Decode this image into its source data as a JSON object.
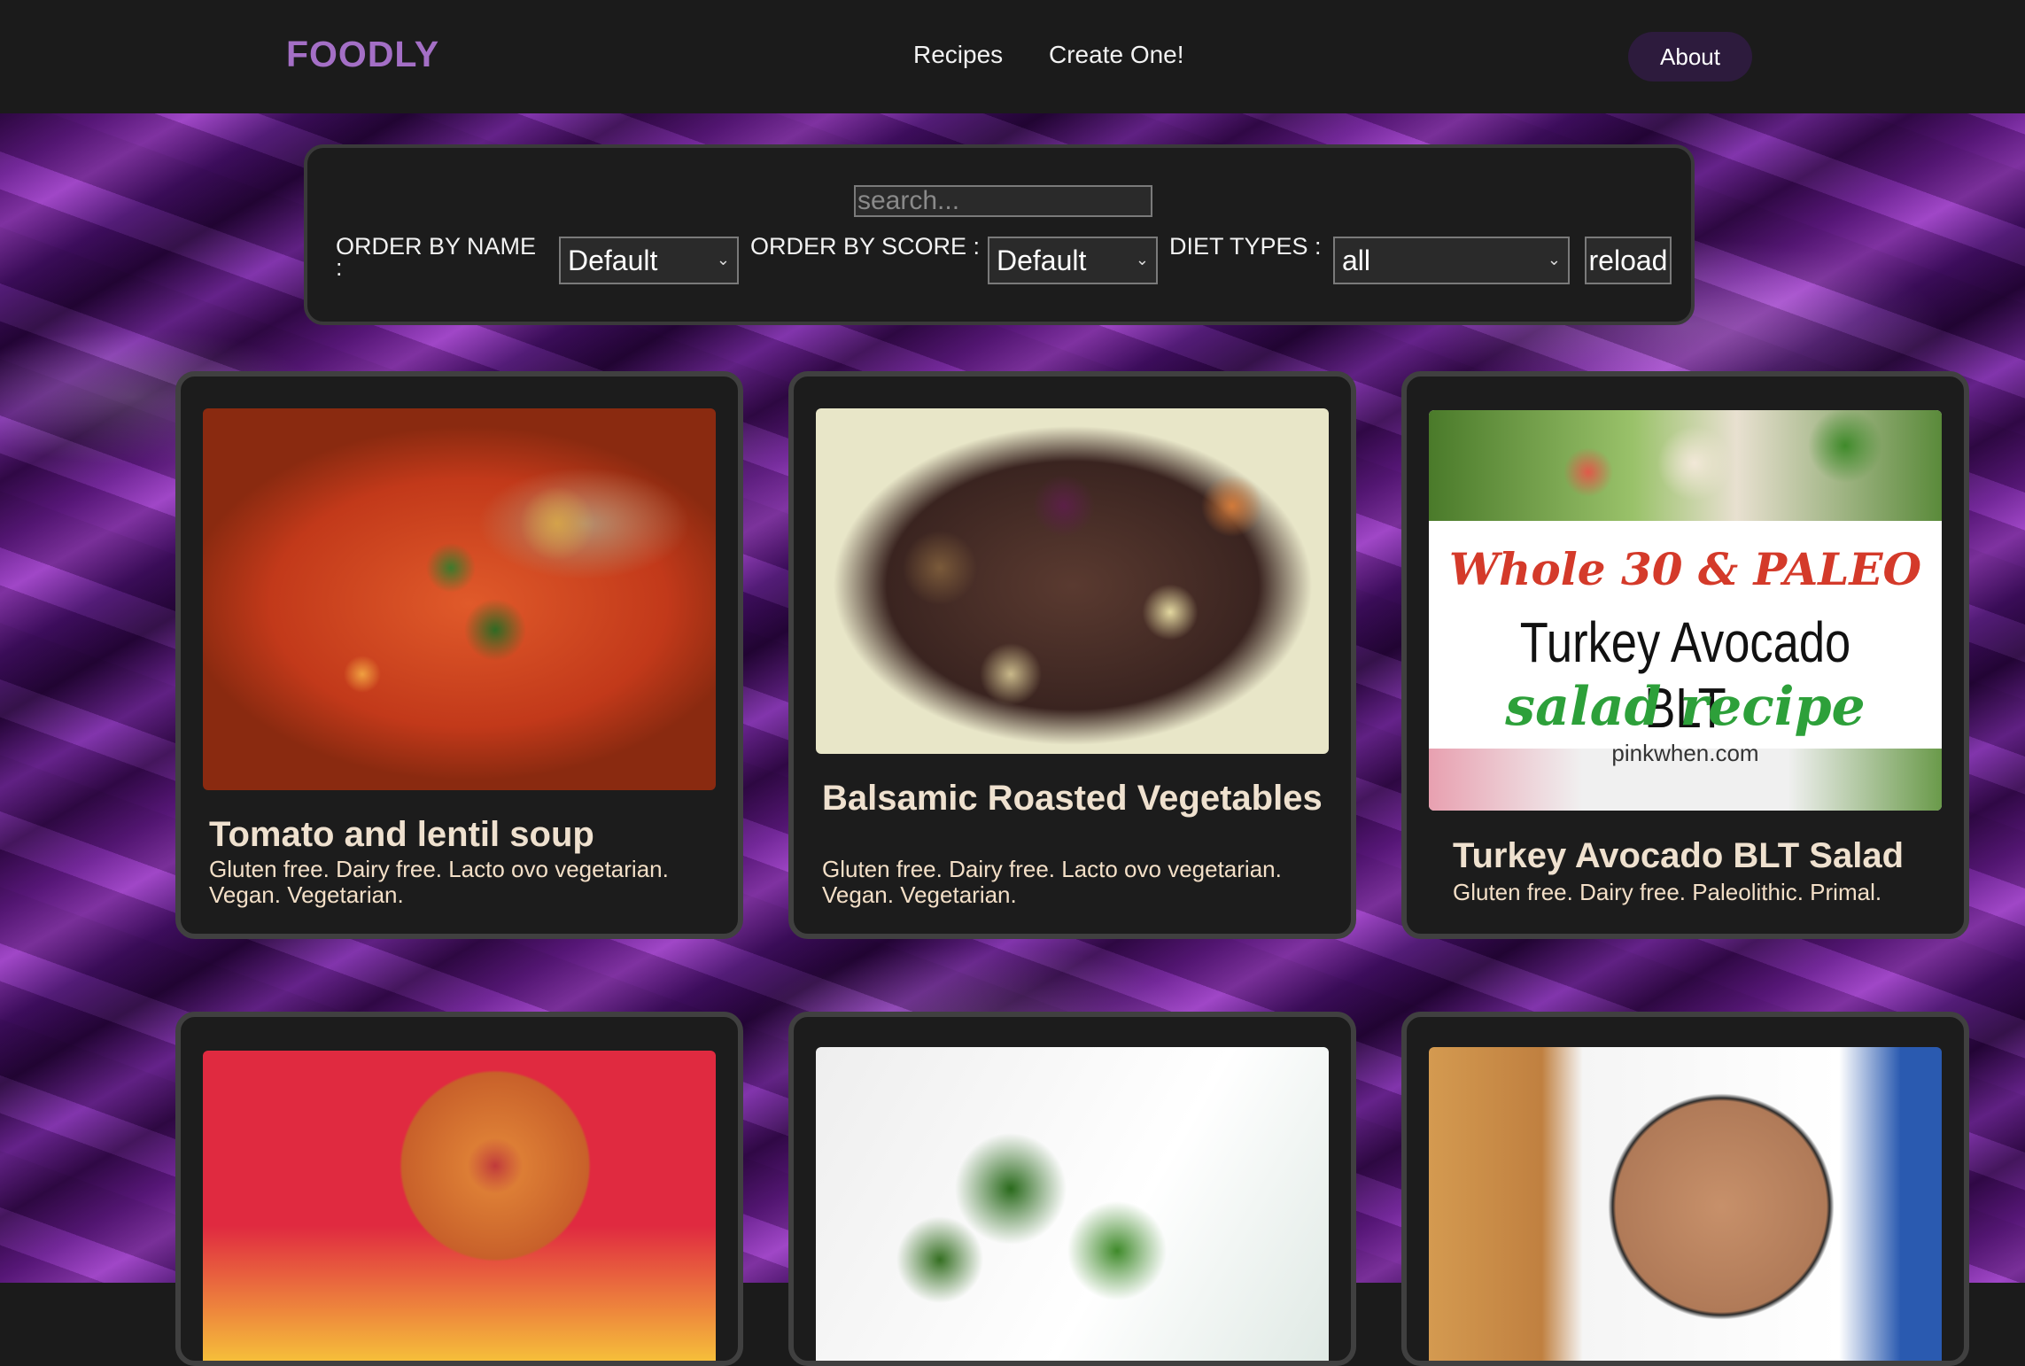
{
  "header": {
    "logo": "FOODLY",
    "nav": [
      "Recipes",
      "Create One!"
    ],
    "about_label": "About"
  },
  "filters": {
    "search_placeholder": "search...",
    "order_by_name_label": "ORDER BY NAME :",
    "order_by_name_value": "Default",
    "order_by_score_label": "ORDER BY SCORE :",
    "order_by_score_value": "Default",
    "diet_types_label": "DIET TYPES :",
    "diet_types_value": "all",
    "reload_label": "reload"
  },
  "cards": [
    {
      "title": "Tomato and lentil soup",
      "diets": "Gluten free. Dairy free. Lacto ovo vegetarian. Vegan. Vegetarian.",
      "image": "tomato-lentil-soup"
    },
    {
      "title": "Balsamic Roasted Vegetables",
      "diets": "Gluten free. Dairy free. Lacto ovo vegetarian. Vegan. Vegetarian.",
      "image": "roasted-vegetables"
    },
    {
      "title": "Turkey Avocado BLT Salad",
      "diets": "Gluten free. Dairy free. Paleolithic. Primal.",
      "image": "turkey-avocado-salad",
      "image_text": [
        "Whole 30 & PALEO",
        "Turkey Avocado BLT",
        "salad recipe",
        "pinkwhen.com"
      ]
    },
    {
      "title": "",
      "diets": "",
      "image": "glazed-donut"
    },
    {
      "title": "",
      "diets": "",
      "image": "broccoli"
    },
    {
      "title": "",
      "diets": "",
      "image": "chocolate-shake"
    }
  ],
  "colors": {
    "accent": "#a46fc6",
    "about_bg": "#2d1b3d",
    "card_bg": "#1c1c1c",
    "card_text": "#efe1cf"
  }
}
